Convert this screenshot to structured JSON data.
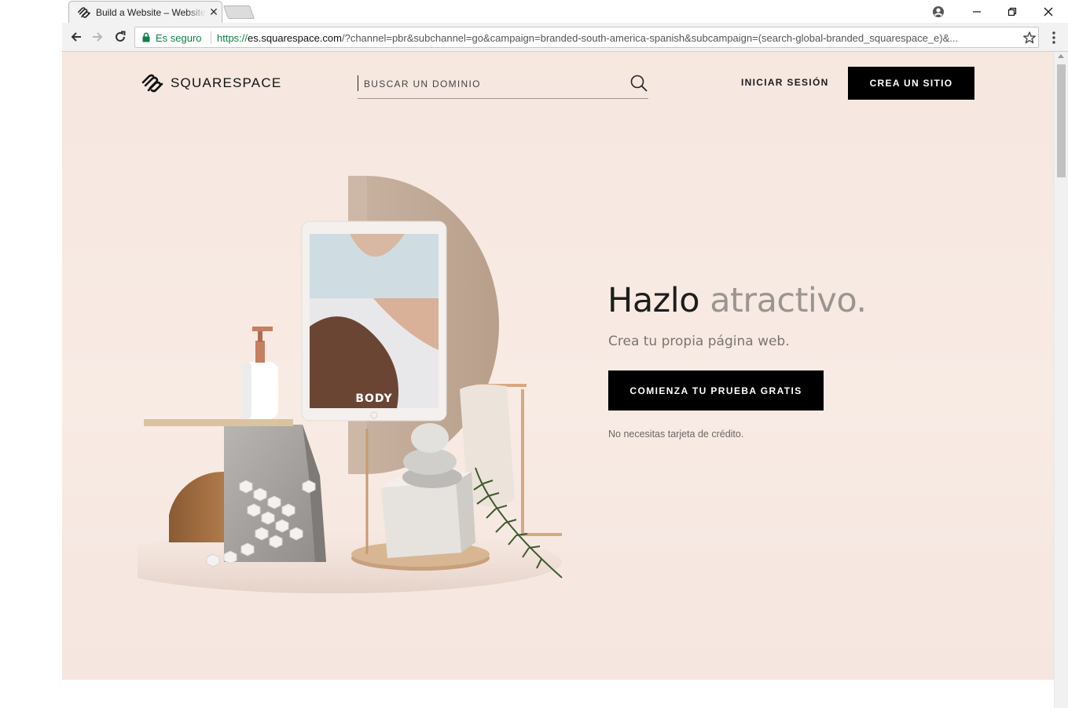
{
  "browser": {
    "tab_title": "Build a Website – Website",
    "secure_label": "Es seguro",
    "url_scheme": "https://",
    "url_host": "es.squarespace.com",
    "url_rest": "/?channel=pbr&subchannel=go&campaign=branded-south-america-spanish&subcampaign=(search-global-branded_squarespace_e)&..."
  },
  "header": {
    "logo_text": "SQUARESPACE",
    "search_placeholder": "BUSCAR UN DOMINIO",
    "signin_label": "INICIAR SESIÓN",
    "cta_label": "CREA UN SITIO"
  },
  "hero": {
    "headline_dark": "Hazlo",
    "headline_light": "atractivo.",
    "subhead": "Crea tu propia página web.",
    "cta_label": "COMIENZA TU PRUEBA GRATIS",
    "note": "No necesitas tarjeta de crédito.",
    "tablet_word": "BODY"
  },
  "colors": {
    "background": "#f7e9e2",
    "button": "#000000",
    "secure_green": "#0b8043",
    "muted_text": "#9b9591"
  },
  "icons": [
    "squarespace-logo-icon",
    "search-icon",
    "lock-icon",
    "star-icon",
    "back-icon",
    "forward-icon",
    "reload-icon",
    "menu-icon",
    "profile-icon"
  ]
}
